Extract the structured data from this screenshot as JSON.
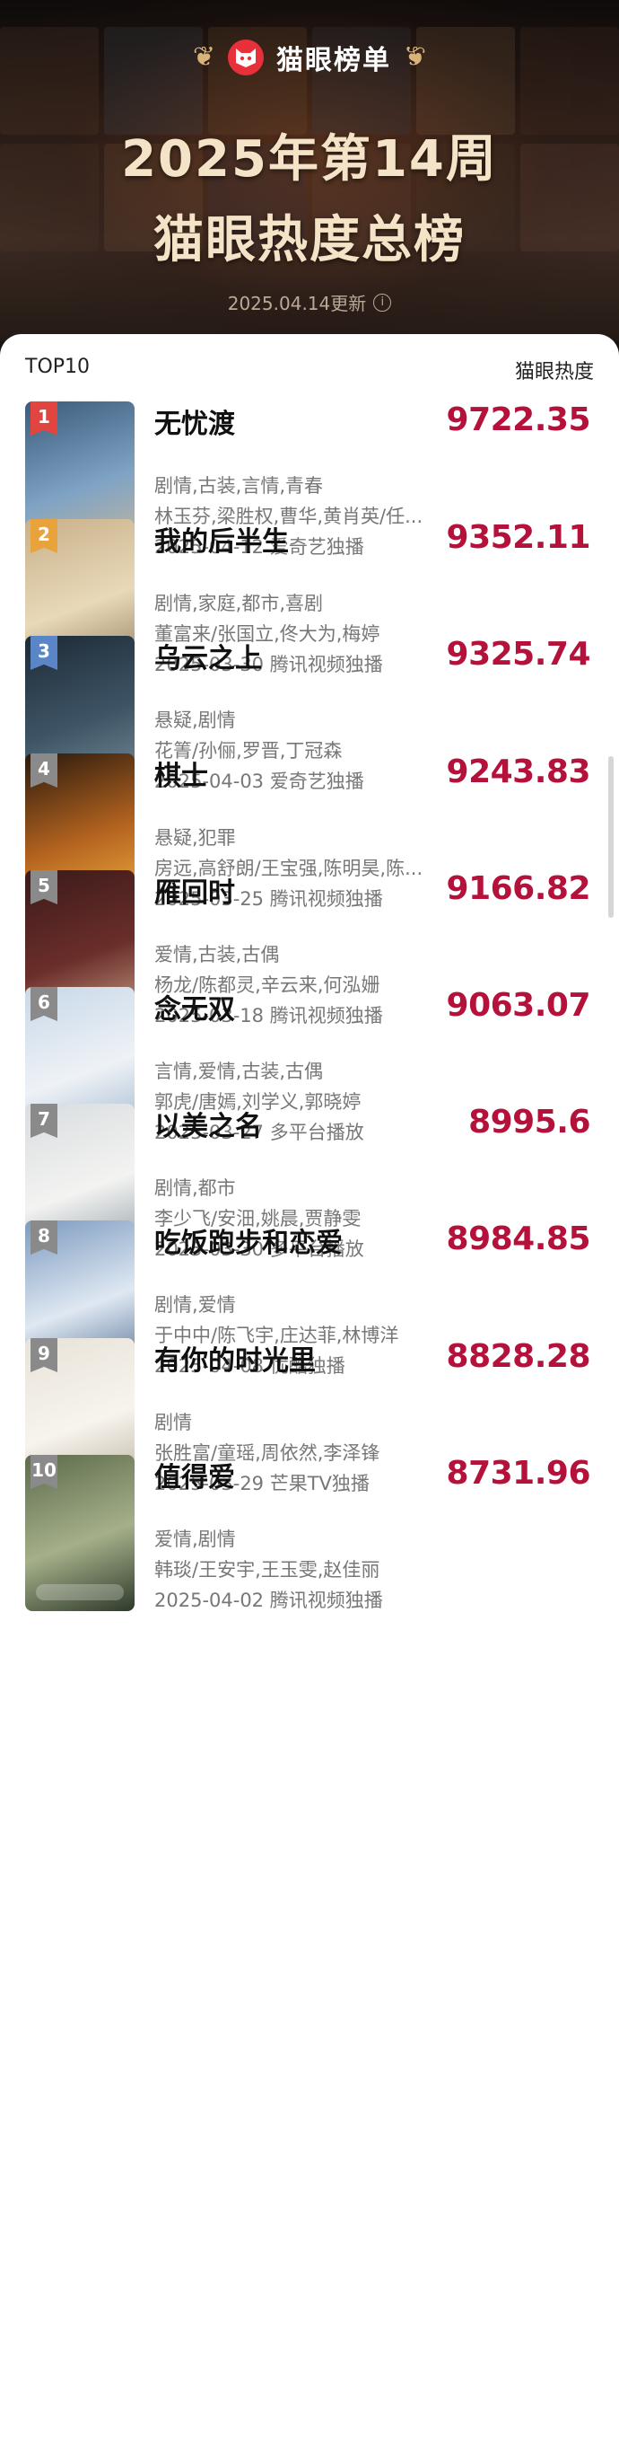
{
  "header": {
    "brand": "猫眼榜单",
    "title_line1": "2025年第14周",
    "title_line2": "猫眼热度总榜",
    "update_text": "2025.04.14更新",
    "info_icon": "info-icon"
  },
  "list": {
    "left_label": "TOP10",
    "right_label": "猫眼热度",
    "items": [
      {
        "rank": "1",
        "name": "无忧渡",
        "genres": "剧情,古装,言情,青春",
        "cast": "林玉芬,梁胜权,曹华,黄肖英/任...",
        "release": "2025-04-12 爱奇艺独播",
        "score": "9722.35",
        "badge_color": "#e2453f",
        "art": [
          "#3b5b7a",
          "#7fa3c4",
          "#c9b79c"
        ]
      },
      {
        "rank": "2",
        "name": "我的后半生",
        "genres": "剧情,家庭,都市,喜剧",
        "cast": "董富来/张国立,佟大为,梅婷",
        "release": "2025-03-30 腾讯视频独播",
        "score": "9352.11",
        "badge_color": "#e9a33d",
        "art": [
          "#c9b089",
          "#e8d9b9",
          "#8f7a5a"
        ]
      },
      {
        "rank": "3",
        "name": "乌云之上",
        "genres": "悬疑,剧情",
        "cast": "花箐/孙俪,罗晋,丁冠森",
        "release": "2025-04-03 爱奇艺独播",
        "score": "9325.74",
        "badge_color": "#5a86c8",
        "art": [
          "#1d2a36",
          "#3e5566",
          "#7a8e99"
        ]
      },
      {
        "rank": "4",
        "name": "棋士",
        "genres": "悬疑,犯罪",
        "cast": "房远,高舒朗/王宝强,陈明昊,陈...",
        "release": "2025-03-25 腾讯视频独播",
        "score": "9243.83",
        "badge_color": "#8a8a8a",
        "art": [
          "#2a1a0e",
          "#b5641f",
          "#f0b040"
        ]
      },
      {
        "rank": "5",
        "name": "雁回时",
        "genres": "爱情,古装,古偶",
        "cast": "杨龙/陈都灵,辛云来,何泓姗",
        "release": "2025-03-18 腾讯视频独播",
        "score": "9166.82",
        "badge_color": "#8a8a8a",
        "art": [
          "#3a1a1a",
          "#6b2e2a",
          "#c9a48a"
        ]
      },
      {
        "rank": "6",
        "name": "念无双",
        "genres": "言情,爱情,古装,古偶",
        "cast": "郭虎/唐嫣,刘学义,郭晓婷",
        "release": "2025-03-27 多平台播放",
        "score": "9063.07",
        "badge_color": "#8a8a8a",
        "art": [
          "#c8d8e8",
          "#eef2f6",
          "#9bb3cc"
        ]
      },
      {
        "rank": "7",
        "name": "以美之名",
        "genres": "剧情,都市",
        "cast": "李少飞/安沺,姚晨,贾静雯",
        "release": "2025-03-30 多平台播放",
        "score": "8995.6",
        "badge_color": "#8a8a8a",
        "art": [
          "#d9dde0",
          "#f3f3f1",
          "#8b9aa3"
        ]
      },
      {
        "rank": "8",
        "name": "吃饭跑步和恋爱",
        "genres": "剧情,爱情",
        "cast": "于中中/陈飞宇,庄达菲,林博洋",
        "release": "2025-04-08 优酷独播",
        "score": "8984.85",
        "badge_color": "#8a8a8a",
        "art": [
          "#7c9bc0",
          "#dfe8f2",
          "#4c6a90"
        ]
      },
      {
        "rank": "9",
        "name": "有你的时光里",
        "genres": "剧情",
        "cast": "张胜富/童瑶,周依然,李泽锋",
        "release": "2025-03-29 芒果TV独播",
        "score": "8828.28",
        "badge_color": "#8a8a8a",
        "art": [
          "#e8e3d8",
          "#f7f4ee",
          "#b9ae98"
        ]
      },
      {
        "rank": "10",
        "name": "值得爱",
        "genres": "爱情,剧情",
        "cast": "韩琰/王安宇,王玉雯,赵佳丽",
        "release": "2025-04-02 腾讯视频独播",
        "score": "8731.96",
        "badge_color": "#8a8a8a",
        "art": [
          "#5d6b4c",
          "#a5b08a",
          "#2e3a2a"
        ]
      }
    ]
  }
}
